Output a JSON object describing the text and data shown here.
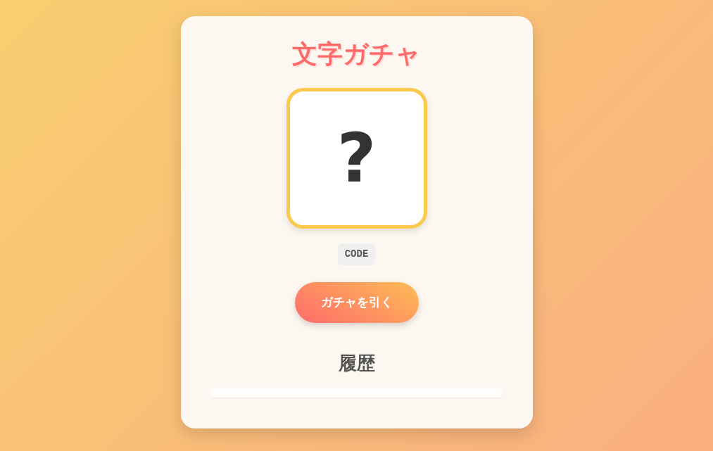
{
  "title": "文字ガチャ",
  "card": {
    "symbol": "?"
  },
  "code": "CODE",
  "button": "ガチャを引く",
  "history": {
    "heading": "履歴"
  }
}
